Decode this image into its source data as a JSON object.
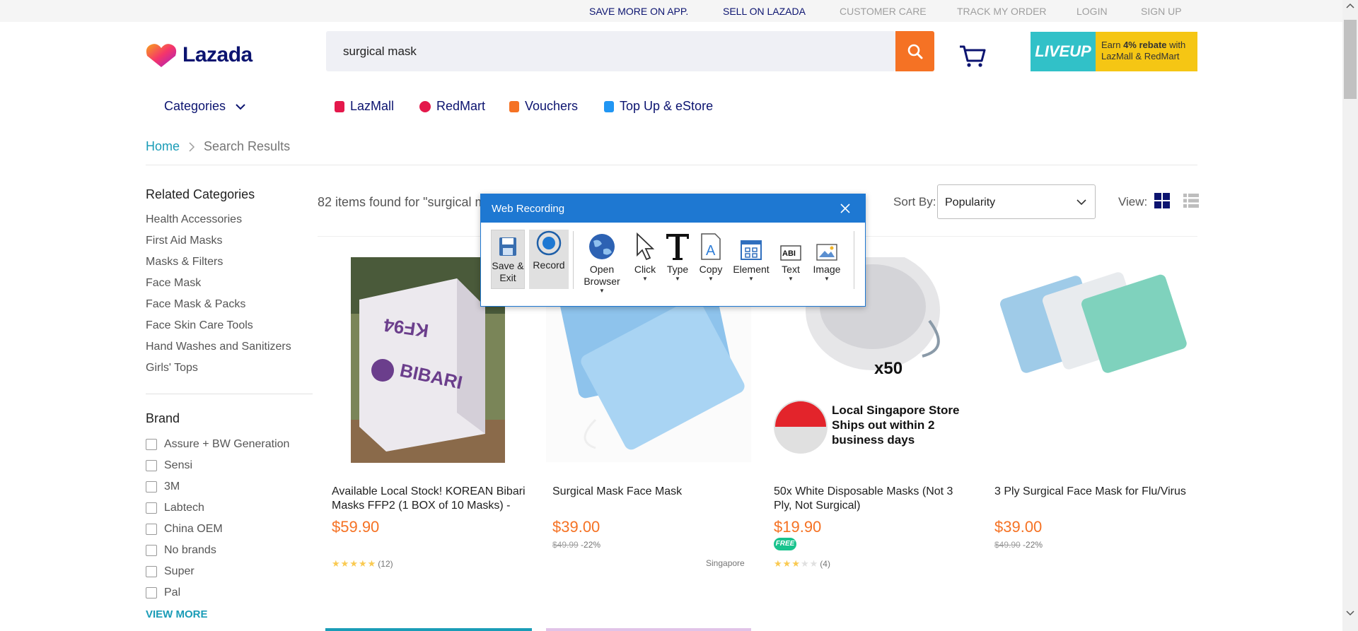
{
  "topbar": {
    "links": [
      {
        "label": "SAVE MORE ON APP.",
        "style": "dark"
      },
      {
        "label": "SELL ON LAZADA",
        "style": "dark"
      },
      {
        "label": "CUSTOMER CARE",
        "style": "grey"
      },
      {
        "label": "TRACK MY ORDER",
        "style": "grey"
      },
      {
        "label": "LOGIN",
        "style": "grey"
      },
      {
        "label": "SIGN UP",
        "style": "grey"
      }
    ]
  },
  "header": {
    "logo_text": "Lazada",
    "search_value": "surgical mask",
    "search_icon": "search-icon",
    "cart_icon": "cart-icon",
    "banner": {
      "logo": "LIVEUP",
      "line1_pre": "Earn ",
      "line1_bold": "4% rebate",
      "line1_post": " with",
      "line2": "LazMall & RedMart"
    }
  },
  "nav": {
    "categories_label": "Categories",
    "items": [
      {
        "label": "LazMall",
        "icon_color": "#e4184b"
      },
      {
        "label": "RedMart",
        "icon_color": "#e4184b"
      },
      {
        "label": "Vouchers",
        "icon_color": "#f57224"
      },
      {
        "label": "Top Up & eStore",
        "icon_color": "#2196f3"
      }
    ]
  },
  "breadcrumb": {
    "home": "Home",
    "current": "Search Results"
  },
  "sidebar": {
    "related_title": "Related Categories",
    "related": [
      "Health Accessories",
      "First Aid Masks",
      "Masks & Filters",
      "Face Mask",
      "Face Mask & Packs",
      "Face Skin Care Tools",
      "Hand Washes and Sanitizers",
      "Girls' Tops"
    ],
    "brand_title": "Brand",
    "brands": [
      "Assure + BW Generation",
      "Sensi",
      "3M",
      "Labtech",
      "China OEM",
      "No brands",
      "Super",
      "Pal"
    ],
    "view_more": "VIEW MORE"
  },
  "results": {
    "found_text": "82 items found for \"surgical m",
    "sort_label": "Sort By:",
    "sort_value": "Popularity",
    "view_label": "View:"
  },
  "products": [
    {
      "title": "Available Local Stock! KOREAN Bibari Masks FFP2 (1 BOX of 10 Masks) -",
      "price": "$59.90",
      "old_price": "",
      "discount": "",
      "rating": 5,
      "reviews": "(12)",
      "location": "",
      "free": false
    },
    {
      "title": "Surgical Mask Face Mask",
      "price": "$39.00",
      "old_price": "$49.99",
      "discount": "-22%",
      "rating": 0,
      "reviews": "",
      "location": "Singapore",
      "free": false
    },
    {
      "title": "50x White Disposable Masks (Not 3 Ply, Not Surgical)",
      "price": "$19.90",
      "old_price": "",
      "discount": "",
      "rating": 2.5,
      "reviews": "(4)",
      "location": "",
      "free": true,
      "free_label": "FREE"
    },
    {
      "title": "3 Ply Surgical Face Mask for Flu/Virus",
      "price": "$39.00",
      "old_price": "$49.90",
      "discount": "-22%",
      "rating": 0,
      "reviews": "",
      "location": "",
      "free": false
    }
  ],
  "product_images": {
    "box_text": "BIBARI",
    "box_text2": "KF94",
    "mask_count": "x50",
    "sg_line1": "Local Singapore Store",
    "sg_line2": "Ships out within 2",
    "sg_line3": "business days"
  },
  "dialog": {
    "title": "Web Recording",
    "tools": [
      {
        "label": "Save & Exit",
        "icon": "save-icon"
      },
      {
        "label": "Record",
        "icon": "record-icon"
      },
      {
        "label": "Open Browser",
        "icon": "globe-icon"
      },
      {
        "label": "Click",
        "icon": "cursor-icon"
      },
      {
        "label": "Type",
        "icon": "type-icon"
      },
      {
        "label": "Copy",
        "icon": "copy-icon"
      },
      {
        "label": "Element",
        "icon": "element-icon"
      },
      {
        "label": "Text",
        "icon": "text-icon"
      },
      {
        "label": "Image",
        "icon": "image-icon"
      }
    ],
    "text_icon_label": "ABI"
  },
  "colors": {
    "accent": "#f57224",
    "brand": "#0c1470",
    "link": "#1a9cb7",
    "dialog": "#1e78d2"
  }
}
